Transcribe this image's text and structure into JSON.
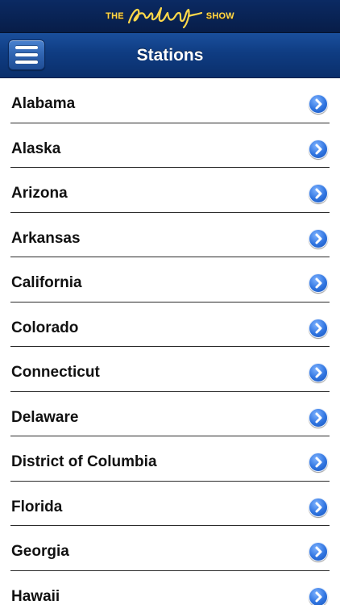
{
  "brand": {
    "the_label": "THE",
    "show_label": "SHOW"
  },
  "nav": {
    "title": "Stations"
  },
  "stations": [
    {
      "label": "Alabama"
    },
    {
      "label": "Alaska"
    },
    {
      "label": "Arizona"
    },
    {
      "label": "Arkansas"
    },
    {
      "label": "California"
    },
    {
      "label": "Colorado"
    },
    {
      "label": "Connecticut"
    },
    {
      "label": "Delaware"
    },
    {
      "label": "District of Columbia"
    },
    {
      "label": "Florida"
    },
    {
      "label": "Georgia"
    },
    {
      "label": "Hawaii"
    }
  ],
  "icons": {
    "menu": "hamburger-menu-icon",
    "disclosure": "chevron-right-circle-icon"
  },
  "colors": {
    "nav_bar": "#0f3c82",
    "brand_gold": "#ffd84a",
    "disclosure_blue": "#2f74e0",
    "separator": "#2b2b2b"
  }
}
